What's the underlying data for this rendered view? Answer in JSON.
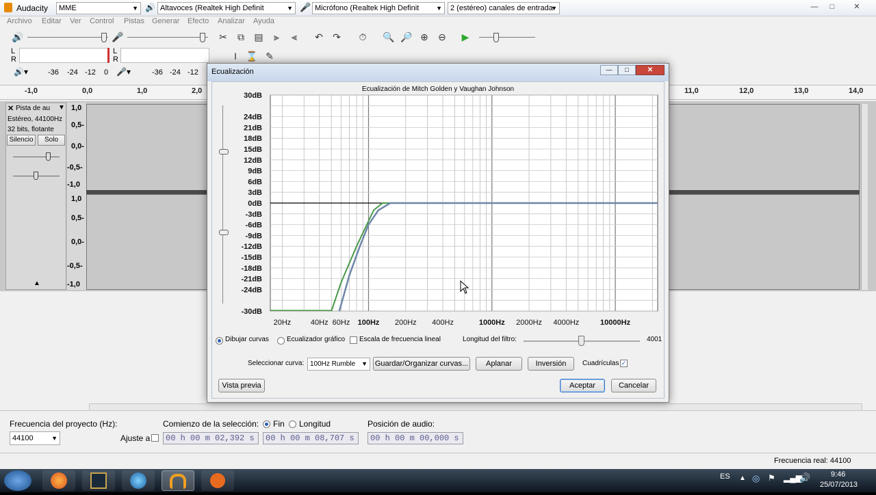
{
  "app": {
    "title": "Audacity",
    "host": "MME",
    "output_device": "Altavoces (Realtek High Definit",
    "input_device": "Micrófono (Realtek High Definit",
    "channels": "2 (estéreo) canales de entrada"
  },
  "window_buttons": {
    "minimize": "—",
    "maximize": "□",
    "close": "✕"
  },
  "menu": [
    "Archivo",
    "Editar",
    "Ver",
    "Control",
    "Pistas",
    "Generar",
    "Efecto",
    "Analizar",
    "Ayuda"
  ],
  "meters": {
    "L": "L",
    "R": "R",
    "ticks": [
      "-36",
      "-24",
      "-12",
      "0"
    ],
    "ticks2": [
      "-36",
      "-24",
      "-12"
    ]
  },
  "ruler": [
    "-1,0",
    "0,0",
    "1,0",
    "2,0",
    "11,0",
    "12,0",
    "13,0",
    "14,0"
  ],
  "track": {
    "name": "Pista de au",
    "info1": "Estéreo, 44100Hz",
    "info2": "32 bits, flotante",
    "mute": "Silencio",
    "solo": "Solo",
    "scale_top": [
      "1,0",
      "0,5-",
      "0,0-",
      "-0,5-",
      "-1,0"
    ],
    "scale_bottom": [
      "1,0",
      "0,5-",
      "0,0-",
      "-0,5-",
      "-1,0"
    ]
  },
  "dialog": {
    "title": "Ecualización",
    "curve_title": "Ecualización de Mitch Golden y Vaughan Johnson",
    "y_labels": [
      "30dB",
      "24dB",
      "21dB",
      "18dB",
      "15dB",
      "12dB",
      "9dB",
      "6dB",
      "3dB",
      "0dB",
      "-3dB",
      "-6dB",
      "-9dB",
      "-12dB",
      "-15dB",
      "-18dB",
      "-21dB",
      "-24dB",
      "-30dB"
    ],
    "x_labels": [
      "20Hz",
      "40Hz",
      "60Hz",
      "100Hz",
      "200Hz",
      "400Hz",
      "1000Hz",
      "2000Hz",
      "4000Hz",
      "10000Hz"
    ],
    "mode_draw": "Dibujar curvas",
    "mode_graphic": "Ecualizador gráfico",
    "linear_scale": "Escala de frecuencia lineal",
    "filter_length_label": "Longitud del filtro:",
    "filter_length_value": "4001",
    "select_curve_label": "Seleccionar curva:",
    "selected_curve": "100Hz Rumble",
    "save_manage": "Guardar/Organizar curvas...",
    "flatten": "Aplanar",
    "invert": "Inversión",
    "grid_label": "Cuadrículas",
    "preview": "Vista previa",
    "ok": "Aceptar",
    "cancel": "Cancelar"
  },
  "chart_data": {
    "type": "line",
    "title": "Ecualización de Mitch Golden y Vaughan Johnson",
    "x_scale": "log",
    "xlim": [
      16,
      22050
    ],
    "ylim": [
      -30,
      30
    ],
    "grid": true,
    "series": [
      {
        "color": "#4a9a4a",
        "x": [
          50,
          60,
          80,
          100,
          110,
          130,
          160,
          22050
        ],
        "y": [
          -30,
          -22,
          -12,
          -5,
          -2,
          0,
          0,
          0
        ]
      },
      {
        "color": "#6f86a9",
        "x": [
          58,
          70,
          85,
          100,
          120,
          150,
          22050
        ],
        "y": [
          -30,
          -20,
          -12,
          -6,
          -2,
          0,
          0
        ]
      }
    ]
  },
  "bottom": {
    "project_rate_label": "Frecuencia del proyecto (Hz):",
    "project_rate": "44100",
    "snap_label": "Ajuste a",
    "selection_start_label": "Comienzo de la selección:",
    "end_label": "Fin",
    "length_label": "Longitud",
    "sel_start": "00 h 00 m 02,392 s",
    "sel_end": "00 h 00 m 08,707 s",
    "audio_pos_label": "Posición de audio:",
    "audio_pos": "00 h 00 m 00,000 s",
    "status_rate": "Frecuencia real: 44100"
  },
  "taskbar": {
    "lang": "ES",
    "time": "9:46",
    "date": "25/07/2013"
  },
  "colors": {
    "accent": "#3a78c9",
    "curve_green": "#4a9a4a",
    "curve_blue": "#6f86a9",
    "play_green": "#2fa82f"
  }
}
